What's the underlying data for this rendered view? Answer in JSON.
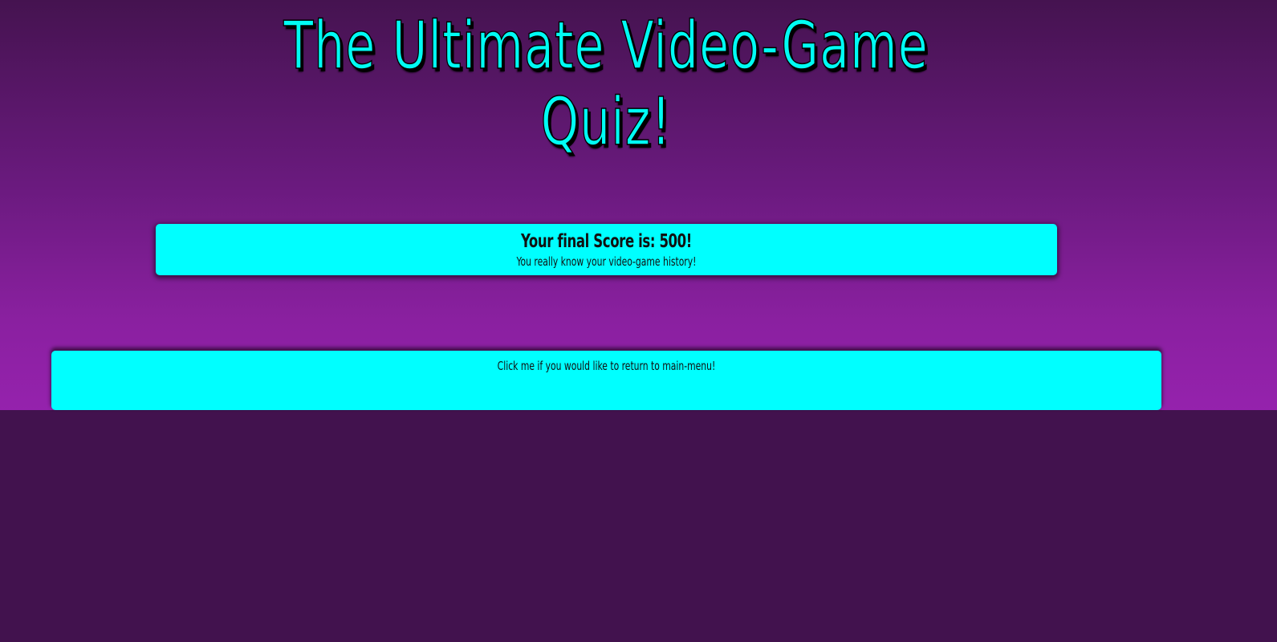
{
  "header": {
    "title_line1": "The Ultimate Video-Game",
    "title_line2": "Quiz!"
  },
  "result": {
    "score_text": "Your final Score is: 500!",
    "score_value": 500,
    "message": "You really know your video-game history!"
  },
  "menu_button": {
    "label": "Click me if you would like to return to main-menu!"
  },
  "colors": {
    "accent": "#00ffff",
    "background_top": "#451350",
    "background_bottom": "#9522ad",
    "page_background": "#42124e"
  }
}
